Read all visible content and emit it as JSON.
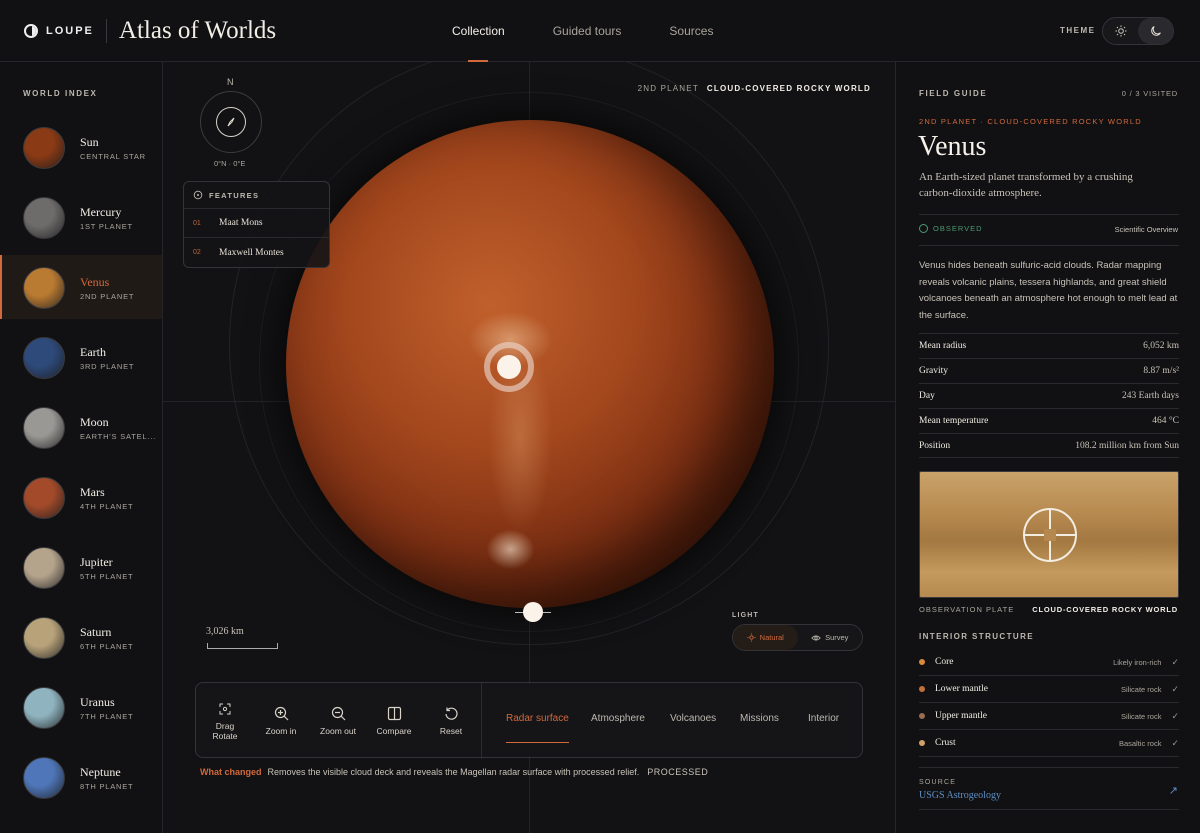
{
  "header": {
    "brand": "LOUPE",
    "title": "Atlas of Worlds",
    "nav": [
      {
        "label": "Collection",
        "active": true
      },
      {
        "label": "Guided tours",
        "active": false
      },
      {
        "label": "Sources",
        "active": false
      }
    ],
    "theme_label": "THEME",
    "theme_options": [
      {
        "icon": "sun-icon",
        "active": false
      },
      {
        "icon": "moon-icon",
        "active": true
      }
    ]
  },
  "sidebar": {
    "label": "WORLD INDEX",
    "worlds": [
      {
        "name": "Sun",
        "sub": "CENTRAL STAR",
        "color": "#8a3a14"
      },
      {
        "name": "Mercury",
        "sub": "1ST PLANET",
        "color": "#6e6c6a"
      },
      {
        "name": "Venus",
        "sub": "2ND PLANET",
        "color": "#b97a32",
        "active": true
      },
      {
        "name": "Earth",
        "sub": "3RD PLANET",
        "color": "#2e4a7a"
      },
      {
        "name": "Moon",
        "sub": "EARTH'S SATEL...",
        "color": "#9a9894"
      },
      {
        "name": "Mars",
        "sub": "4TH PLANET",
        "color": "#a24a2a"
      },
      {
        "name": "Jupiter",
        "sub": "5TH PLANET",
        "color": "#b5a48c"
      },
      {
        "name": "Saturn",
        "sub": "6TH PLANET",
        "color": "#b8a27a"
      },
      {
        "name": "Uranus",
        "sub": "7TH PLANET",
        "color": "#8fb4bf"
      },
      {
        "name": "Neptune",
        "sub": "8TH PLANET",
        "color": "#4e76b8"
      }
    ]
  },
  "viewport": {
    "compass_n": "N",
    "coords": "0°N · 0°E",
    "features_label": "FEATURES",
    "features": [
      {
        "num": "01",
        "name": "Maat Mons"
      },
      {
        "num": "02",
        "name": "Maxwell Montes"
      }
    ],
    "label_dim": "2ND PLANET",
    "label_bold": "CLOUD-COVERED ROCKY WORLD",
    "scale": "3,026 km",
    "light_label": "LIGHT",
    "light_options": [
      {
        "label": "Natural",
        "icon": "sun-icon",
        "active": true
      },
      {
        "label": "Survey",
        "icon": "eye-icon",
        "active": false
      }
    ],
    "tools": [
      {
        "label": "Drag\nRotate",
        "icon": "drag-rotate-icon"
      },
      {
        "label": "Zoom in",
        "icon": "zoom-in-icon"
      },
      {
        "label": "Zoom out",
        "icon": "zoom-out-icon"
      },
      {
        "label": "Compare",
        "icon": "compare-icon"
      },
      {
        "label": "Reset",
        "icon": "reset-icon"
      }
    ],
    "layers": [
      {
        "label": "Radar surface",
        "active": true
      },
      {
        "label": "Atmosphere",
        "active": false
      },
      {
        "label": "Volcanoes",
        "active": false
      },
      {
        "label": "Missions",
        "active": false
      },
      {
        "label": "Interior",
        "active": false
      }
    ],
    "changed_label": "What changed",
    "changed_text": "Removes the visible cloud deck and reveals the Magellan radar surface with processed relief.",
    "changed_status": "PROCESSED"
  },
  "guide": {
    "label": "FIELD GUIDE",
    "visited": "0 / 3 VISITED",
    "kicker": "2ND PLANET · CLOUD-COVERED ROCKY WORLD",
    "title": "Venus",
    "lede": "An Earth-sized planet transformed by a crushing carbon-dioxide atmosphere.",
    "status": "OBSERVED",
    "overview": "Scientific Overview",
    "body": "Venus hides beneath sulfuric-acid clouds. Radar mapping reveals volcanic plains, tessera highlands, and great shield volcanoes beneath an atmosphere hot enough to melt lead at the surface.",
    "facts": [
      {
        "k": "Mean radius",
        "v": "6,052 km"
      },
      {
        "k": "Gravity",
        "v": "8.87 m/s²"
      },
      {
        "k": "Day",
        "v": "243 Earth days"
      },
      {
        "k": "Mean temperature",
        "v": "464 °C"
      },
      {
        "k": "Position",
        "v": "108.2 million km from Sun"
      }
    ],
    "plate_label": "OBSERVATION PLATE",
    "plate_caption": "CLOUD-COVERED ROCKY WORLD",
    "interior_label": "INTERIOR STRUCTURE",
    "interior": [
      {
        "name": "Core",
        "comp": "Likely iron-rich",
        "color": "#d98a3a"
      },
      {
        "name": "Lower mantle",
        "comp": "Silicate rock",
        "color": "#c4703a"
      },
      {
        "name": "Upper mantle",
        "comp": "Silicate rock",
        "color": "#9a6a52"
      },
      {
        "name": "Crust",
        "comp": "Basaltic rock",
        "color": "#d4a06a"
      }
    ],
    "source_label": "SOURCE",
    "source_link": "USGS Astrogeology"
  },
  "colors": {
    "accent": "#d2693c",
    "observed": "#4a9a72",
    "link": "#5e8fc4"
  }
}
